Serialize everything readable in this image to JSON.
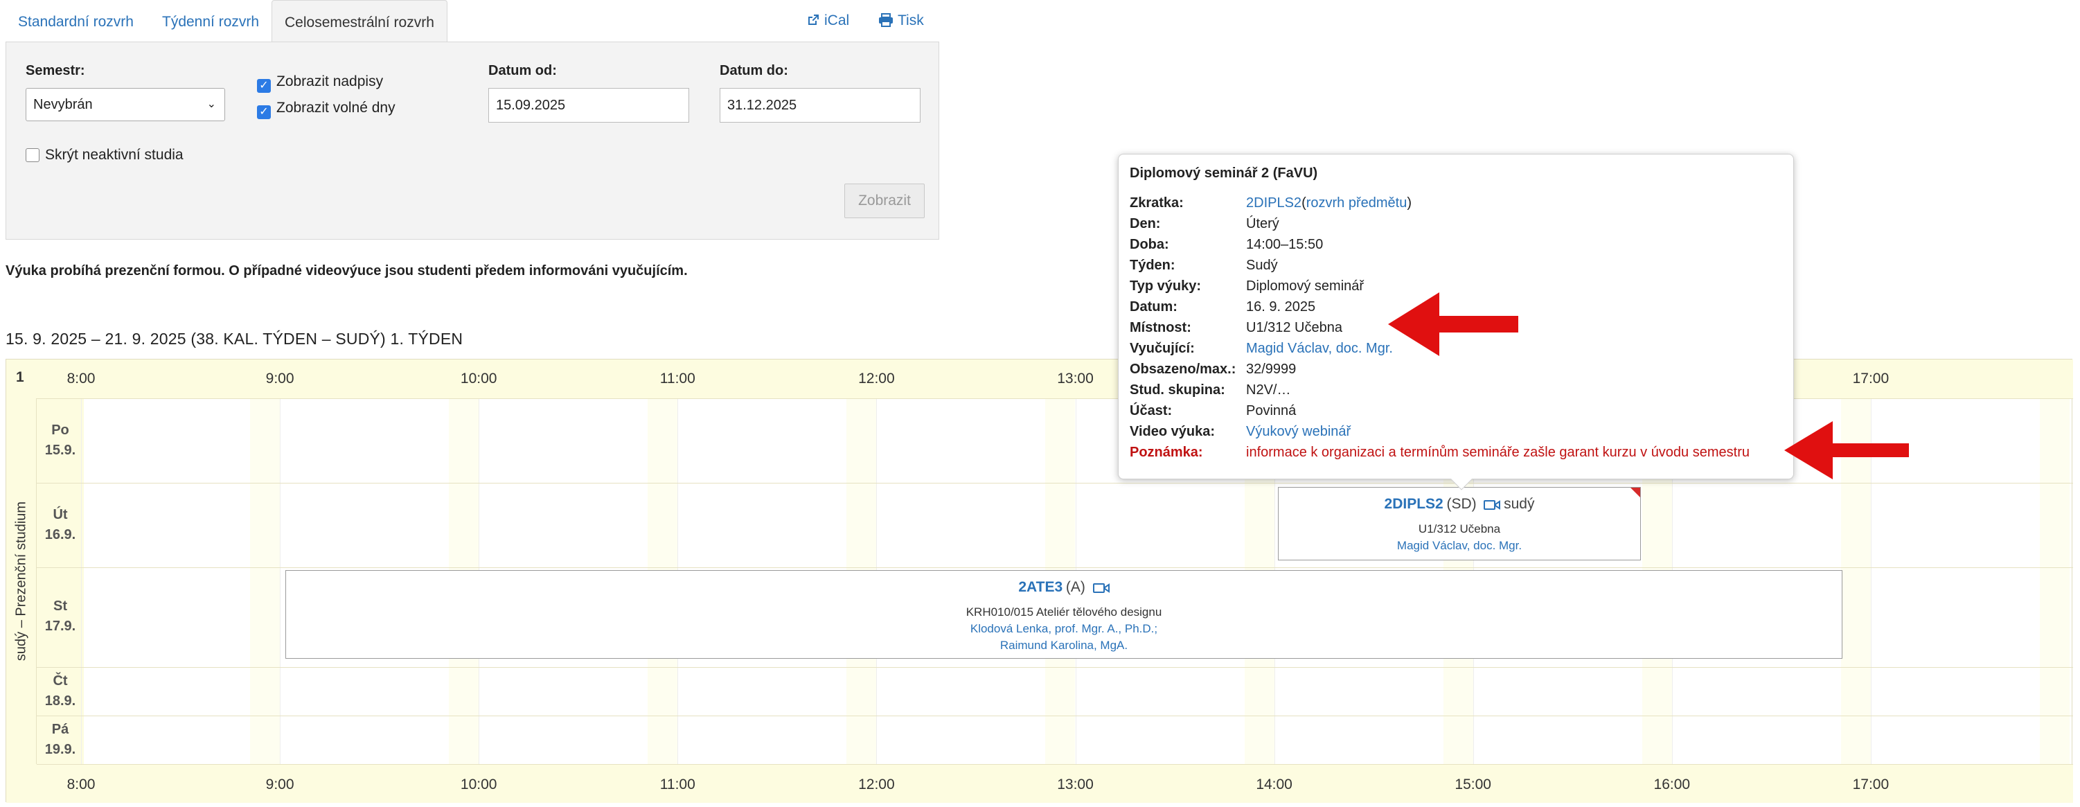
{
  "tabs": [
    {
      "label": "Standardní rozvrh"
    },
    {
      "label": "Týdenní rozvrh"
    },
    {
      "label": "Celosemestrální rozvrh"
    }
  ],
  "links": {
    "ical": "iCal",
    "print": "Tisk"
  },
  "filter": {
    "semester_label": "Semestr:",
    "semester_value": "Nevybrán",
    "show_headings": "Zobrazit nadpisy",
    "show_free_days": "Zobrazit volné dny",
    "hide_inactive": "Skrýt neaktivní studia",
    "date_from_label": "Datum od:",
    "date_from": "15.09.2025",
    "date_to_label": "Datum do:",
    "date_to": "31.12.2025",
    "submit": "Zobrazit",
    "show_headings_checked": true,
    "show_free_days_checked": true,
    "hide_inactive_checked": false
  },
  "notice": "Výuka probíhá prezenční formou. O případné videovýuce jsou studenti předem informováni vyučujícím.",
  "week_title": "15. 9. 2025 – 21. 9. 2025 (38. KAL. TÝDEN – SUDÝ) 1. TÝDEN",
  "timetable": {
    "week_number": "1",
    "side_label": "sudý – Prezenční studium",
    "hours": [
      "8:00",
      "9:00",
      "10:00",
      "11:00",
      "12:00",
      "13:00",
      "14:00",
      "15:00",
      "16:00",
      "17:00"
    ],
    "days": [
      {
        "name": "Po",
        "date": "15.9."
      },
      {
        "name": "Út",
        "date": "16.9."
      },
      {
        "name": "St",
        "date": "17.9."
      },
      {
        "name": "Čt",
        "date": "18.9."
      },
      {
        "name": "Pá",
        "date": "19.9."
      }
    ],
    "events": [
      {
        "code": "2DIPLS2",
        "type": "(SD)",
        "week": "sudý",
        "room": "U1/312 Učebna",
        "teachers": [
          "Magid Václav, doc. Mgr."
        ]
      },
      {
        "code": "2ATE3",
        "type": "(A)",
        "week": "",
        "room": "KRH010/015 Ateliér tělového designu",
        "teachers": [
          "Klodová Lenka, prof. Mgr. A., Ph.D.;",
          "Raimund Karolina, MgA."
        ]
      }
    ]
  },
  "tooltip": {
    "title": "Diplomový seminář 2 (FaVU)",
    "rows": {
      "abbr": {
        "k": "Zkratka:",
        "code": "2DIPLS2",
        "paren_open": "(",
        "link": "rozvrh předmětu",
        "paren_close": ")"
      },
      "day": {
        "k": "Den:",
        "v": "Úterý"
      },
      "time": {
        "k": "Doba:",
        "v": "14:00–15:50"
      },
      "week": {
        "k": "Týden:",
        "v": "Sudý"
      },
      "type": {
        "k": "Typ výuky:",
        "v": "Diplomový seminář"
      },
      "date": {
        "k": "Datum:",
        "v": "16. 9. 2025"
      },
      "room": {
        "k": "Místnost:",
        "v": "U1/312 Učebna"
      },
      "teacher": {
        "k": "Vyučující:",
        "v": "Magid Václav, doc. Mgr."
      },
      "capacity": {
        "k": "Obsazeno/max.:",
        "v": "32/9999"
      },
      "group": {
        "k": "Stud. skupina:",
        "v": "N2V/…"
      },
      "attendance": {
        "k": "Účast:",
        "v": "Povinná"
      },
      "video": {
        "k": "Video výuka:",
        "v": "Výukový webinář"
      },
      "note": {
        "k": "Poznámka:",
        "v": "informace k organizaci a termínům semináře zašle garant kurzu v úvodu semestru"
      }
    }
  },
  "colors": {
    "link": "#2a72b8",
    "highlight": "#c01212",
    "arrow": "#e01010",
    "header_bg": "#fdfce0"
  }
}
